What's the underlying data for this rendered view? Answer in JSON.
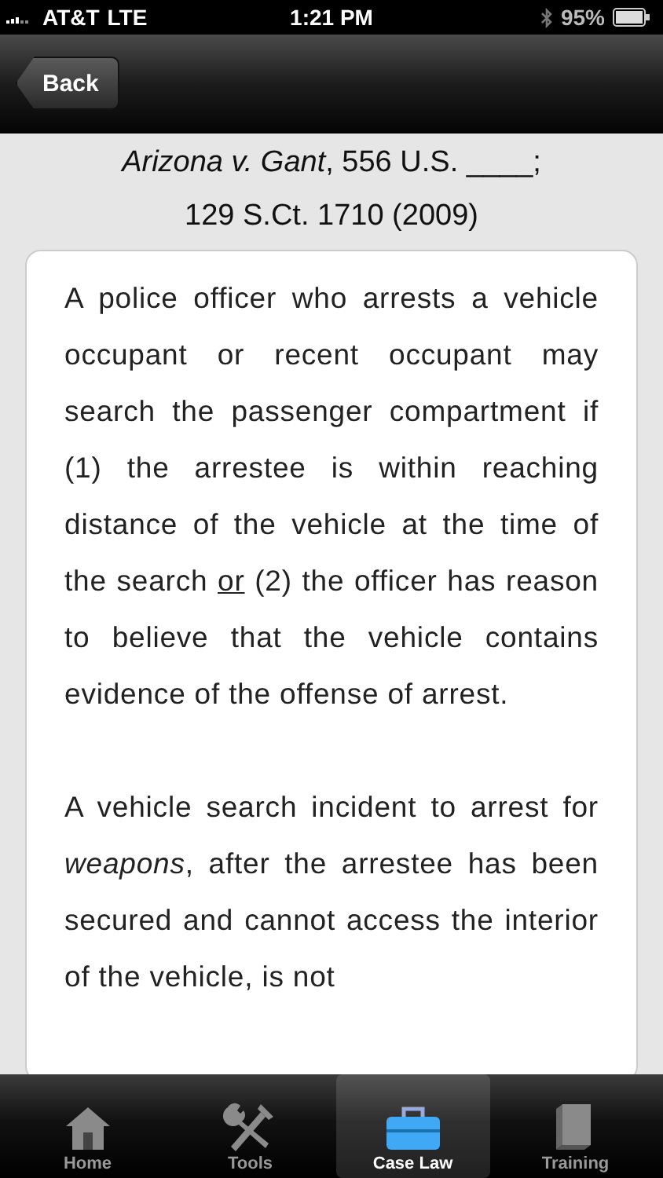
{
  "status_bar": {
    "carrier": "AT&T",
    "network": "LTE",
    "time": "1:21 PM",
    "battery": "95%"
  },
  "nav": {
    "back": "Back"
  },
  "header": {
    "lines": [
      "*Arizona v. Gant*, 556 U.S. ____;",
      "129 S.Ct. 1710 (2009)"
    ]
  },
  "paragraphs": [
    {
      "segments": [
        {
          "text": "A police officer who arrests a vehicle occupant or recent occupant may search the passenger compartment if (1) the arrestee is within reaching distance of the vehicle at the time of the search ",
          "underline": false
        },
        {
          "text": "or",
          "underline": true
        },
        {
          "text": " (2) the officer has reason to believe that the vehicle contains evidence of the offense of arrest.",
          "underline": false
        }
      ]
    },
    {
      "segments": [
        {
          "text": "A vehicle search incident to arrest for *weapons*, after the arrestee has been secured and cannot access the interior of the vehicle, is not",
          "underline": false
        }
      ]
    }
  ],
  "tabs": [
    {
      "label": "Home",
      "kind": "home",
      "selected": false
    },
    {
      "label": "Tools",
      "kind": "tools",
      "selected": false
    },
    {
      "label": "Case Law",
      "kind": "case",
      "selected": true
    },
    {
      "label": "Training",
      "kind": "book",
      "selected": false
    }
  ]
}
